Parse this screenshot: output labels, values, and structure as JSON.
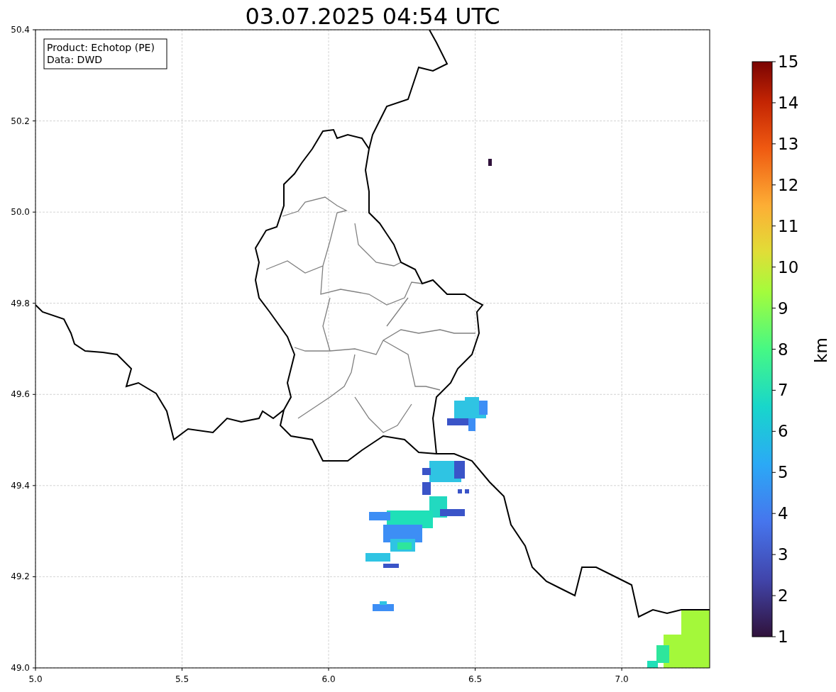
{
  "title": "03.07.2025 04:54 UTC",
  "info_box": {
    "lines": [
      "Product: Echotop (PE)",
      "Data: DWD"
    ]
  },
  "x_ticks": [
    "5.0",
    "5.5",
    "6.0",
    "6.5",
    "7.0"
  ],
  "y_ticks": [
    "50.4",
    "50.2",
    "50.0",
    "49.8",
    "49.6",
    "49.4",
    "49.2",
    "49.0"
  ],
  "colorbar": {
    "label": "km",
    "ticks": [
      "15",
      "14",
      "13",
      "12",
      "11",
      "10",
      "9",
      "8",
      "7",
      "6",
      "5",
      "4",
      "3",
      "2",
      "1"
    ]
  }
}
